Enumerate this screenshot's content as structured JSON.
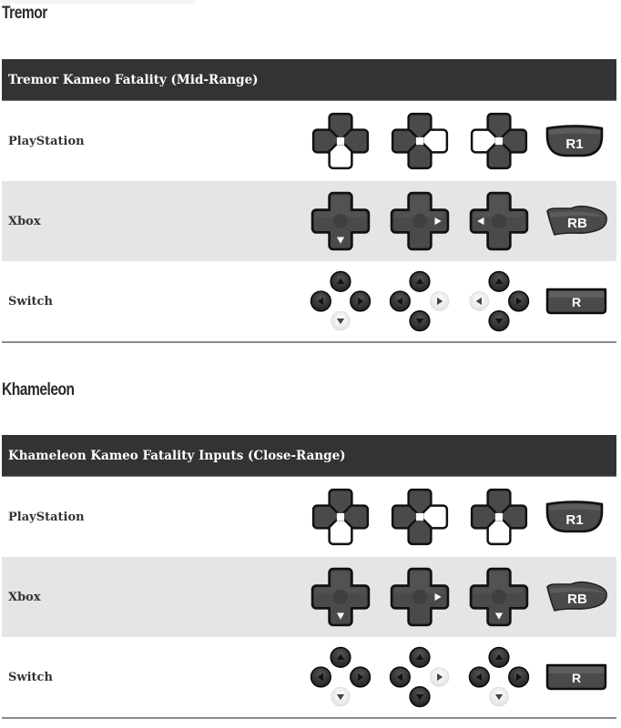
{
  "sections": [
    {
      "character": "Tremor",
      "table_title": "Tremor Kameo Fatality (Mid-Range)",
      "rows": [
        {
          "platform": "PlayStation",
          "style": "ps",
          "inputs": [
            "down",
            "right",
            "left"
          ],
          "button": "R1"
        },
        {
          "platform": "Xbox",
          "style": "xbox",
          "inputs": [
            "down",
            "right",
            "left"
          ],
          "button": "RB"
        },
        {
          "platform": "Switch",
          "style": "switch",
          "inputs": [
            "down",
            "right",
            "left"
          ],
          "button": "R"
        }
      ]
    },
    {
      "character": "Khameleon",
      "table_title": "Khameleon Kameo Fatality Inputs (Close-Range)",
      "rows": [
        {
          "platform": "PlayStation",
          "style": "ps",
          "inputs": [
            "down",
            "right",
            "down"
          ],
          "button": "R1"
        },
        {
          "platform": "Xbox",
          "style": "xbox",
          "inputs": [
            "down",
            "right",
            "down"
          ],
          "button": "RB"
        },
        {
          "platform": "Switch",
          "style": "switch",
          "inputs": [
            "down",
            "right",
            "down"
          ],
          "button": "R"
        }
      ]
    }
  ],
  "colors": {
    "header_bg": "#333333",
    "alt_row_bg": "#e5e5e5",
    "button_dark": "#4a4a4a",
    "button_outline": "#111111"
  }
}
